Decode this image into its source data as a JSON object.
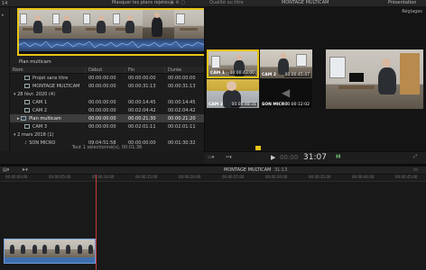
{
  "top": {
    "left_number": "14",
    "title_fragment": "Masquer les plans rejetés",
    "viewer_fragment": "Qualité ou titre",
    "viewer_title": "MONTAGE MULTICAM",
    "settings_label": "Réglages",
    "right_fragment": "Présentation"
  },
  "browser": {
    "clip_caption": "Plan multicam",
    "columns": [
      "Nom",
      "Début",
      "Fin",
      "Durée"
    ],
    "rows": [
      {
        "name": "Projet sans titre",
        "start": "00:00:00:00",
        "end": "00:00:00:00",
        "dur": "00:00:00:00",
        "indent": 1,
        "selected": false
      },
      {
        "name": "MONTAGE MULTICAM",
        "start": "00:00:00:00",
        "end": "00:00:31:13",
        "dur": "00:00:31:13",
        "indent": 1,
        "selected": false
      },
      {
        "name": "28 févr. 2020  (4)",
        "start": "",
        "end": "",
        "dur": "",
        "indent": 0,
        "selected": false
      },
      {
        "name": "CAM 1",
        "start": "00:00:00:00",
        "end": "00:00:14:45",
        "dur": "00:00:14:45",
        "indent": 2,
        "selected": false
      },
      {
        "name": "CAM 2",
        "start": "00:00:00:00",
        "end": "00:02:04:42",
        "dur": "00:02:04:42",
        "indent": 2,
        "selected": false
      },
      {
        "name": "Plan multicam",
        "start": "00:00:00:00",
        "end": "00:00:21:30",
        "dur": "00:00:21:20",
        "indent": 2,
        "selected": true
      },
      {
        "name": "CAM 3",
        "start": "00:00:00:00",
        "end": "00:02:01:11",
        "dur": "00:02:01:11",
        "indent": 2,
        "selected": false
      },
      {
        "name": "2 mars 2018  (1)",
        "start": "",
        "end": "",
        "dur": "",
        "indent": 0,
        "selected": false
      },
      {
        "name": "SON MICRO",
        "start": "09:04:51:58",
        "end": "00:00:00:00",
        "dur": "00:01:30:32",
        "indent": 2,
        "selected": false
      }
    ],
    "status": "Tout 1 sélectionné(s), 00:01:36"
  },
  "angles": [
    {
      "label": "CAM 1",
      "tc": "00:00:43:00",
      "active": true
    },
    {
      "label": "CAM 2",
      "tc": "00:00:45:47",
      "active": false
    },
    {
      "label": "CAM 3",
      "tc": "00:00:48:31",
      "active": false
    },
    {
      "label": "SON MICRO",
      "tc": "00:00:12:02",
      "active": false
    }
  ],
  "transport": {
    "timecode": "31:07",
    "timecode_prefix": "00:00"
  },
  "timeline": {
    "title": "MONTAGE MULTICAM",
    "duration": "31:13",
    "ruler": [
      "00:00:00:00",
      "00:00:05:00",
      "00:00:10:00",
      "00:00:15:00",
      "00:00:20:00",
      "00:00:25:00",
      "00:00:30:00",
      "00:00:35:00",
      "00:00:40:00",
      "00:00:45:00",
      "00:00:50:00"
    ]
  },
  "colors": {
    "accent_yellow": "#e8c418",
    "selection_blue": "#3a6fb0",
    "clip_blue": "#2e5e9e",
    "playhead": "#d03a3a"
  }
}
